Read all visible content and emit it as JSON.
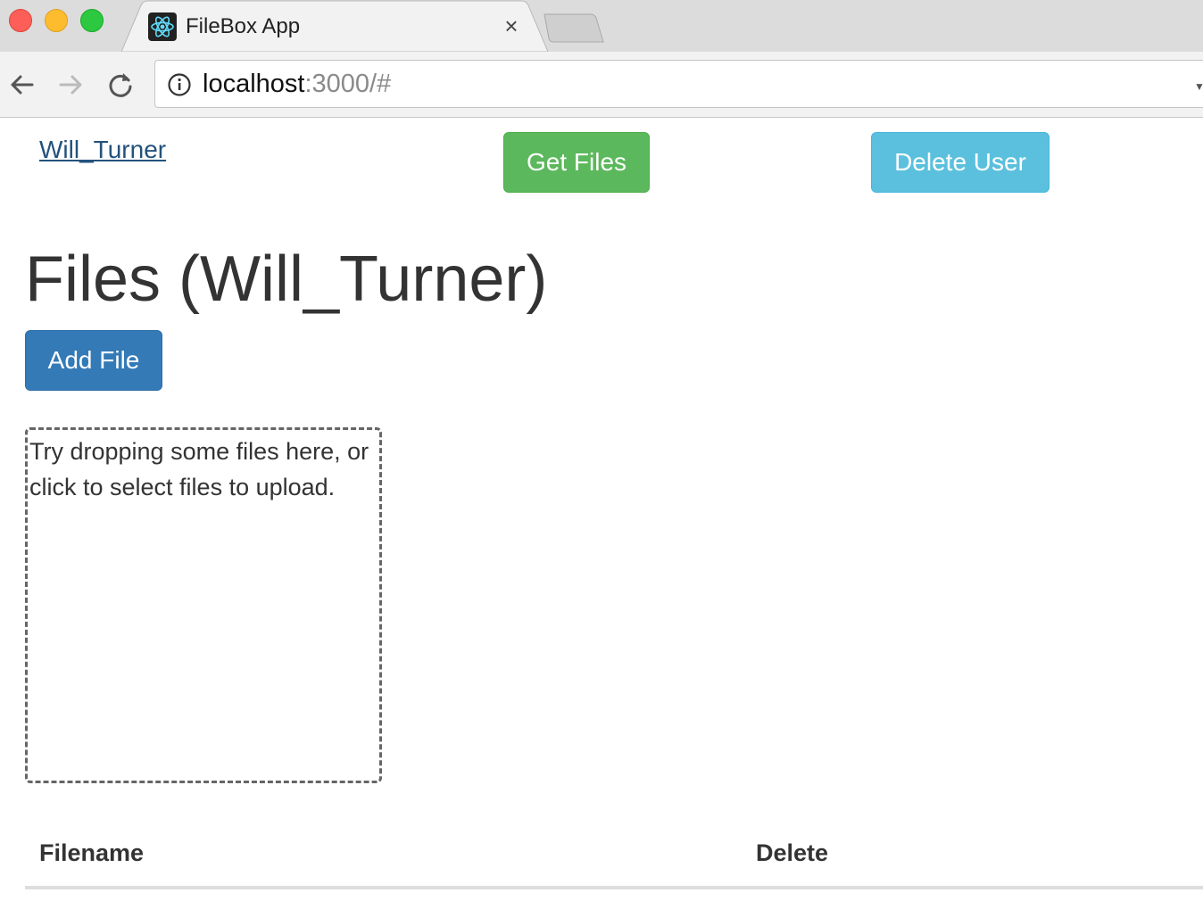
{
  "browser": {
    "tab_title": "FileBox App",
    "tab_close": "×",
    "url_host": "localhost",
    "url_rest": ":3000/#"
  },
  "header": {
    "user_link": "Will_Turner",
    "get_files_label": "Get Files",
    "delete_user_label": "Delete User"
  },
  "main": {
    "title": "Files (Will_Turner)",
    "add_file_label": "Add File",
    "dropzone_text": "Try dropping some files here, or click to select files to upload."
  },
  "files_table": {
    "columns": [
      "Filename",
      "Delete"
    ],
    "rows": []
  },
  "colors": {
    "success": "#5cb85c",
    "info": "#5bc0de",
    "primary": "#337ab7",
    "link": "#23527c"
  },
  "icons": {
    "favicon": "react-icon",
    "back": "arrow-left-icon",
    "forward": "arrow-right-icon",
    "reload": "reload-icon",
    "site_info": "info-icon"
  }
}
